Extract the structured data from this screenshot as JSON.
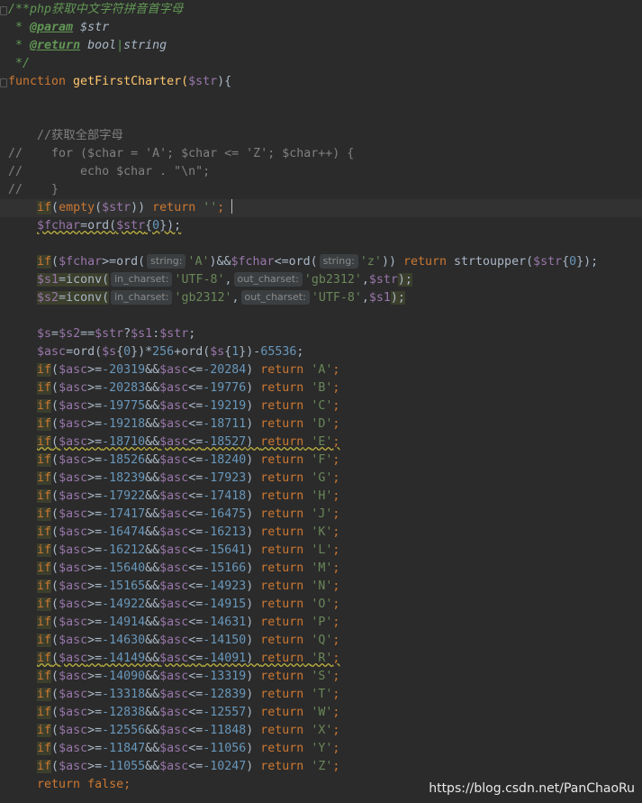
{
  "editor": {
    "lines": [
      [
        {
          "t": "/**php获取中文字符拼音首字母",
          "c": "c-doc"
        }
      ],
      [
        {
          "t": " * ",
          "c": "c-doc"
        },
        {
          "t": "@param",
          "c": "c-doctag"
        },
        {
          "t": " $str",
          "c": "c-doctype"
        }
      ],
      [
        {
          "t": " * ",
          "c": "c-doc"
        },
        {
          "t": "@return",
          "c": "c-doctag"
        },
        {
          "t": " bool",
          "c": "c-doctype"
        },
        {
          "t": "|",
          "c": "c-doc"
        },
        {
          "t": "string",
          "c": "c-doctype"
        }
      ],
      [
        {
          "t": " */",
          "c": "c-doc"
        }
      ],
      [
        {
          "t": "function",
          "c": "c-kw"
        },
        {
          "t": " getFirstCharter(",
          "c": "c-fnname"
        },
        {
          "t": "$str",
          "c": "c-var"
        },
        {
          "t": "){",
          "c": "c-plain"
        }
      ],
      [],
      [],
      [
        {
          "t": "    //获取全部字母",
          "c": "c-comment"
        }
      ],
      [
        {
          "t": "//    for ($char = 'A'; $char <= 'Z'; $char++) {",
          "c": "c-comment"
        }
      ],
      [
        {
          "t": "//        echo $char . \"\\n\";",
          "c": "c-comment"
        }
      ],
      [
        {
          "t": "//    }",
          "c": "c-comment"
        }
      ],
      [
        {
          "t": "    ",
          "c": "c-plain"
        },
        {
          "t": "if",
          "c": "c-kw bg-if"
        },
        {
          "t": "(",
          "c": "c-plain"
        },
        {
          "t": "empty",
          "c": "c-kw"
        },
        {
          "t": "(",
          "c": "c-plain"
        },
        {
          "t": "$str",
          "c": "c-var"
        },
        {
          "t": ")) ",
          "c": "c-plain"
        },
        {
          "t": "return",
          "c": "c-kw"
        },
        {
          "t": " ",
          "c": "c-plain"
        },
        {
          "t": "''",
          "c": "c-str"
        },
        {
          "t": "; ",
          "c": "c-kw"
        },
        {
          "caret": true
        }
      ],
      [
        {
          "t": "    ",
          "c": "c-plain"
        },
        {
          "t": "$fchar",
          "c": "c-var warn"
        },
        {
          "t": "=ord(",
          "c": "c-plain warn"
        },
        {
          "t": "$str",
          "c": "c-var warn"
        },
        {
          "t": "{",
          "c": "c-plain warn"
        },
        {
          "t": "0",
          "c": "c-num warn"
        },
        {
          "t": "});",
          "c": "c-plain warn"
        }
      ],
      [],
      [
        {
          "t": "    ",
          "c": "c-plain"
        },
        {
          "t": "if",
          "c": "c-kw bg-if"
        },
        {
          "t": "(",
          "c": "c-plain"
        },
        {
          "t": "$fchar",
          "c": "c-var"
        },
        {
          "t": ">=ord(",
          "c": "c-plain"
        },
        {
          "hint": "string:"
        },
        {
          "t": "'A'",
          "c": "c-str"
        },
        {
          "t": ")&&",
          "c": "c-plain"
        },
        {
          "t": "$fchar",
          "c": "c-var"
        },
        {
          "t": "<=ord(",
          "c": "c-plain"
        },
        {
          "hint": "string:"
        },
        {
          "t": "'z'",
          "c": "c-str"
        },
        {
          "t": ")) ",
          "c": "c-plain"
        },
        {
          "t": "return",
          "c": "c-kw"
        },
        {
          "t": " strtoupper(",
          "c": "c-plain"
        },
        {
          "t": "$str",
          "c": "c-var"
        },
        {
          "t": "{",
          "c": "c-plain"
        },
        {
          "t": "0",
          "c": "c-num"
        },
        {
          "t": "});",
          "c": "c-plain"
        }
      ],
      [
        {
          "t": "    ",
          "c": "c-plain"
        },
        {
          "t": "$s1",
          "c": "c-var bg-if"
        },
        {
          "t": "=iconv(",
          "c": "c-iconv"
        },
        {
          "hint": "in_charset:"
        },
        {
          "t": "'UTF-8'",
          "c": "c-str"
        },
        {
          "t": ",",
          "c": "c-plain"
        },
        {
          "hint": "out_charset:"
        },
        {
          "t": "'gb2312'",
          "c": "c-str"
        },
        {
          "t": ",",
          "c": "c-plain"
        },
        {
          "t": "$str",
          "c": "c-var"
        },
        {
          "t": ");",
          "c": "c-iconv"
        }
      ],
      [
        {
          "t": "    ",
          "c": "c-plain"
        },
        {
          "t": "$s2",
          "c": "c-var bg-if"
        },
        {
          "t": "=iconv(",
          "c": "c-iconv"
        },
        {
          "hint": "in_charset:"
        },
        {
          "t": "'gb2312'",
          "c": "c-str"
        },
        {
          "t": ",",
          "c": "c-plain"
        },
        {
          "hint": "out_charset:"
        },
        {
          "t": "'UTF-8'",
          "c": "c-str"
        },
        {
          "t": ",",
          "c": "c-plain"
        },
        {
          "t": "$s1",
          "c": "c-var"
        },
        {
          "t": ");",
          "c": "c-iconv"
        }
      ],
      [],
      [
        {
          "t": "    ",
          "c": "c-plain"
        },
        {
          "t": "$s",
          "c": "c-var"
        },
        {
          "t": "=",
          "c": "c-plain"
        },
        {
          "t": "$s2",
          "c": "c-var"
        },
        {
          "t": "==",
          "c": "c-plain"
        },
        {
          "t": "$str",
          "c": "c-var"
        },
        {
          "t": "?",
          "c": "c-plain"
        },
        {
          "t": "$s1",
          "c": "c-var"
        },
        {
          "t": ":",
          "c": "c-plain"
        },
        {
          "t": "$str",
          "c": "c-var"
        },
        {
          "t": ";",
          "c": "c-plain"
        }
      ],
      [
        {
          "t": "    ",
          "c": "c-plain"
        },
        {
          "t": "$asc",
          "c": "c-var"
        },
        {
          "t": "=ord(",
          "c": "c-plain"
        },
        {
          "t": "$s",
          "c": "c-var"
        },
        {
          "t": "{",
          "c": "c-plain"
        },
        {
          "t": "0",
          "c": "c-num"
        },
        {
          "t": "})*",
          "c": "c-plain"
        },
        {
          "t": "256",
          "c": "c-num"
        },
        {
          "t": "+ord(",
          "c": "c-plain"
        },
        {
          "t": "$s",
          "c": "c-var"
        },
        {
          "t": "{",
          "c": "c-plain"
        },
        {
          "t": "1",
          "c": "c-num"
        },
        {
          "t": "})-",
          "c": "c-plain"
        },
        {
          "t": "65536",
          "c": "c-num"
        },
        {
          "t": ";",
          "c": "c-plain"
        }
      ]
    ],
    "ranges": [
      [
        "-20319",
        "-20284",
        "'A'",
        false
      ],
      [
        "-20283",
        "-19776",
        "'B'",
        false
      ],
      [
        "-19775",
        "-19219",
        "'C'",
        false
      ],
      [
        "-19218",
        "-18711",
        "'D'",
        false
      ],
      [
        "-18710",
        "-18527",
        "'E'",
        true
      ],
      [
        "-18526",
        "-18240",
        "'F'",
        false
      ],
      [
        "-18239",
        "-17923",
        "'G'",
        false
      ],
      [
        "-17922",
        "-17418",
        "'H'",
        false
      ],
      [
        "-17417",
        "-16475",
        "'J'",
        false
      ],
      [
        "-16474",
        "-16213",
        "'K'",
        false
      ],
      [
        "-16212",
        "-15641",
        "'L'",
        false
      ],
      [
        "-15640",
        "-15166",
        "'M'",
        false
      ],
      [
        "-15165",
        "-14923",
        "'N'",
        false
      ],
      [
        "-14922",
        "-14915",
        "'O'",
        false
      ],
      [
        "-14914",
        "-14631",
        "'P'",
        false
      ],
      [
        "-14630",
        "-14150",
        "'Q'",
        false
      ],
      [
        "-14149",
        "-14091",
        "'R'",
        true
      ],
      [
        "-14090",
        "-13319",
        "'S'",
        false
      ],
      [
        "-13318",
        "-12839",
        "'T'",
        false
      ],
      [
        "-12838",
        "-12557",
        "'W'",
        false
      ],
      [
        "-12556",
        "-11848",
        "'X'",
        false
      ],
      [
        "-11847",
        "-11056",
        "'Y'",
        false
      ],
      [
        "-11055",
        "-10247",
        "'Z'",
        false
      ]
    ],
    "final_lines": [
      [
        {
          "t": "    ",
          "c": "c-plain"
        },
        {
          "t": "return",
          "c": "c-kw"
        },
        {
          "t": " ",
          "c": "c-plain"
        },
        {
          "t": "false",
          "c": "c-kw"
        },
        {
          "t": ";",
          "c": "c-kw"
        }
      ]
    ],
    "caret_line": 11,
    "fold_lines": [
      0,
      4
    ]
  },
  "watermark": "https://blog.csdn.net/PanChaoRu"
}
